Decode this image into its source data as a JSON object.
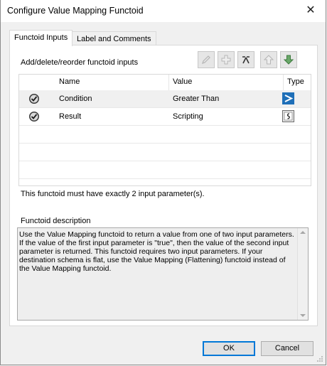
{
  "window": {
    "title": "Configure Value Mapping Functoid",
    "close_glyph": "✕"
  },
  "tabs": [
    {
      "label": "Functoid Inputs",
      "active": true
    },
    {
      "label": "Label and Comments",
      "active": false
    }
  ],
  "inputs": {
    "header_label": "Add/delete/reorder functoid inputs",
    "toolbar": [
      {
        "name": "edit-icon",
        "enabled": false
      },
      {
        "name": "add-icon",
        "enabled": false
      },
      {
        "name": "delete-icon",
        "enabled": true
      },
      {
        "name": "move-up-icon",
        "enabled": false
      },
      {
        "name": "move-down-icon",
        "enabled": true
      }
    ],
    "columns": [
      "Name",
      "Value",
      "Type"
    ],
    "rows": [
      {
        "name": "Condition",
        "value": "Greater Than",
        "type_icon": "greater-than-icon"
      },
      {
        "name": "Result",
        "value": "Scripting",
        "type_icon": "script-icon"
      }
    ],
    "message": "This functoid must have exactly 2 input parameter(s)."
  },
  "description": {
    "label": "Functoid description",
    "text": "Use the Value Mapping functoid to return a value from one of two input parameters. If the value of the first input parameter is \"true\", then the value of the second input parameter is returned. This functoid requires two input parameters. If your destination schema is flat, use the Value Mapping (Flattening) functoid instead of the Value Mapping functoid."
  },
  "buttons": {
    "ok": "OK",
    "cancel": "Cancel"
  },
  "colors": {
    "accent": "#0078d7",
    "type_gt": "#1e6fb8"
  }
}
